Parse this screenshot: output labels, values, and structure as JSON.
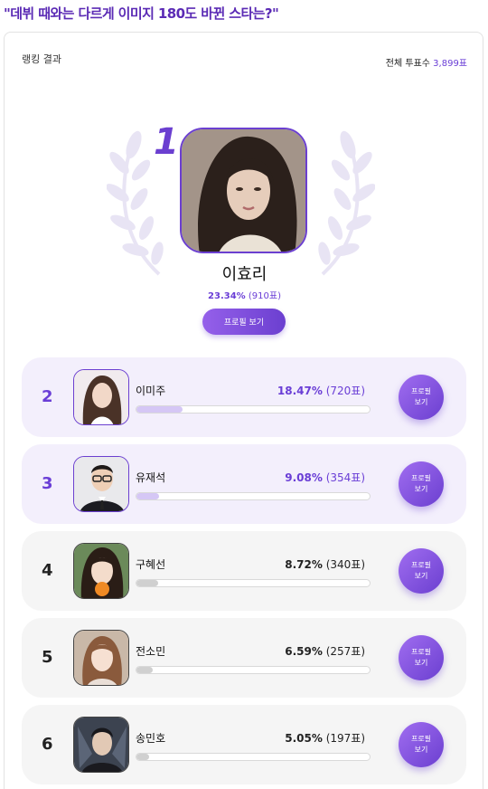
{
  "headline": "\"데뷔 때와는 다르게 이미지 180도 바뀐 스타는?\"",
  "card": {
    "title": "랭킹 결과",
    "total_label": "전체 투표수",
    "total_value": "3,899표"
  },
  "winner": {
    "rank": "1",
    "name": "이효리",
    "percent": "23.34%",
    "votes": "(910표)",
    "button_label": "프로필 보기",
    "share": 0.2334
  },
  "rankings": [
    {
      "rank": "2",
      "name": "이미주",
      "percent": "18.47%",
      "votes": "(720표)",
      "share": 0.1847,
      "button_label": "프로필 보기"
    },
    {
      "rank": "3",
      "name": "유재석",
      "percent": "9.08%",
      "votes": "(354표)",
      "share": 0.0908,
      "button_label": "프로필 보기"
    },
    {
      "rank": "4",
      "name": "구혜선",
      "percent": "8.72%",
      "votes": "(340표)",
      "share": 0.0872,
      "button_label": "프로필 보기"
    },
    {
      "rank": "5",
      "name": "전소민",
      "percent": "6.59%",
      "votes": "(257표)",
      "share": 0.0659,
      "button_label": "프로필 보기"
    },
    {
      "rank": "6",
      "name": "송민호",
      "percent": "5.05%",
      "votes": "(197표)",
      "share": 0.0505,
      "button_label": "프로필 보기"
    }
  ],
  "colors": {
    "accent": "#6b3fd0",
    "highlight_row": "#f3effc",
    "normal_row": "#f5f5f5"
  }
}
